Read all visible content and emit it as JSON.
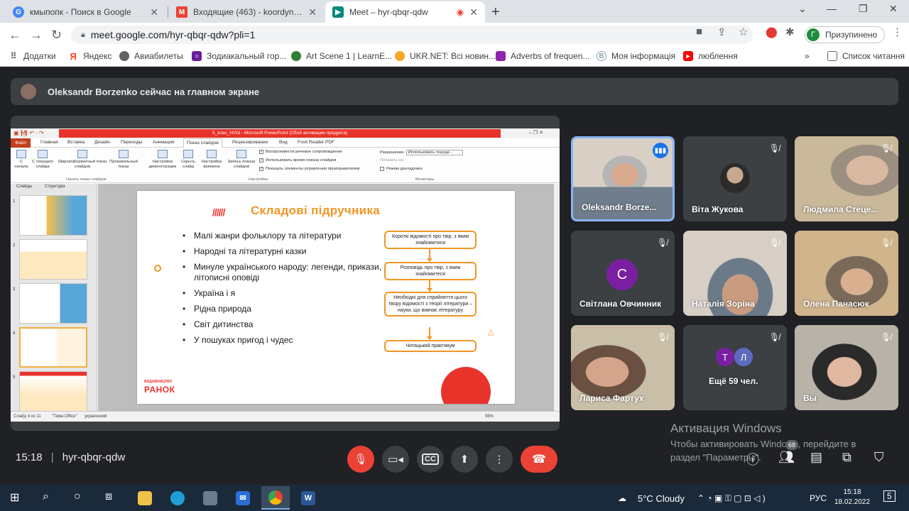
{
  "browser": {
    "tabs": [
      {
        "label": "кмыпопк - Поиск в Google",
        "icon": "google-icon",
        "color": "#4285f4"
      },
      {
        "label": "Входящие (463) - koordynatzia@",
        "icon": "gmail-icon",
        "color": "#ea4335"
      },
      {
        "label": "Meet – hyr-qbqr-qdw",
        "icon": "meet-icon",
        "color": "#00897b"
      }
    ],
    "new_tab": "+",
    "address": "meet.google.com/hyr-qbqr-qdw?pli=1",
    "profile_initial": "Г",
    "profile_label": "Призупинено",
    "bookmarks": [
      {
        "label": "Додатки",
        "color": "#5f6368"
      },
      {
        "label": "Яндекс",
        "color": "#fc3f1d"
      },
      {
        "label": "Авиабилеты",
        "color": "#5f6368"
      },
      {
        "label": "Зодиакальный гор...",
        "color": "#6a1b9a"
      },
      {
        "label": "Art Scene 1 | LearnE...",
        "color": "#2e7d32"
      },
      {
        "label": "UKR.NET: Всі новин...",
        "color": "#f9a825"
      },
      {
        "label": "Adverbs of frequen...",
        "color": "#8e24aa"
      },
      {
        "label": "Моя інформація",
        "color": "#90a4ae"
      },
      {
        "label": "люблення",
        "color": "#ff0000"
      }
    ],
    "bookmarks_more": "»",
    "reading_list": "Список читання"
  },
  "meet": {
    "banner": "Oleksandr Borzenko сейчас на главном экране",
    "time": "15:18",
    "meeting_code": "hyr-qbqr-qdw",
    "people_count": "68",
    "participants": [
      {
        "name": "Oleksandr Borze...",
        "speaking": true
      },
      {
        "name": "Віта Жукова"
      },
      {
        "name": "Людмила Стеце..."
      },
      {
        "name": "Світлана Овчинник",
        "initial": "С"
      },
      {
        "name": "Наталія Зоріна"
      },
      {
        "name": "Олена Панасюк"
      },
      {
        "name": "Лариса Фартух"
      },
      {
        "name": "Ещё 59 чел.",
        "initials": [
          "Т",
          "Л"
        ]
      },
      {
        "name": "Вы"
      }
    ],
    "watermark_title": "Активация Windows",
    "watermark_text": "Чтобы активировать Windows, перейдите в раздел \"Параметры\"."
  },
  "ppt": {
    "window_title": "5_клас_НУШ - Microsoft PowerPoint (Сбой активации продукта)",
    "menu": [
      "Файл",
      "Главная",
      "Вставка",
      "Дизайн",
      "Переходы",
      "Анимация",
      "Показ слайдов",
      "Рецензирование",
      "Вид",
      "Foxit Reader PDF"
    ],
    "ribbon_buttons": [
      "С начала",
      "С текущего слайда",
      "Широкоформатный показ слайдов",
      "Произвольный показ",
      "Настройка демонстрации",
      "Скрыть слайд",
      "Настройка времени",
      "Запись показа слайдов"
    ],
    "ribbon_checks": [
      "Воспроизвести речевое сопровождение",
      "Использовать время показа слайдов",
      "Показать элементы управления проигрывателем",
      "Режим докладчика"
    ],
    "ribbon_groups": [
      "Начать показ слайдов",
      "Настройка",
      "Мониторы"
    ],
    "resolution_label": "Разрешение:",
    "resolution_value": "Использовать текуще...",
    "show_on_label": "Показать на:",
    "panel_tabs": [
      "Слайды",
      "Структура"
    ],
    "status": [
      "Слайд 4 из 11",
      "\"Тема Office\"",
      "украинский",
      "98%"
    ],
    "slide": {
      "title": "Складові підручника",
      "bullets": [
        "Малі жанри фольклору та літератури",
        "Народні та літературні казки",
        "Минуле українського народу: легенди, прикази, літописні оповіді",
        "Україна і я",
        "Рідна природа",
        "Світ дитинства",
        "У пошуках пригод і чудес"
      ],
      "flow": [
        "Короткі відомості про твір, з яким знайомитися",
        "Розповідь про твір, з яким знайомитеся",
        "Необхідні для сприйняття цього твору відомості з теорії літератури – науки, що вивчає літературу",
        "Читацький практикум"
      ],
      "logo_small": "ВИДАВНИЦТВО",
      "logo": "РАНОК"
    }
  },
  "taskbar": {
    "weather": "5°C  Cloudy",
    "lang": "РУС",
    "time": "15:18",
    "date": "18.02.2022",
    "notif": "5"
  }
}
